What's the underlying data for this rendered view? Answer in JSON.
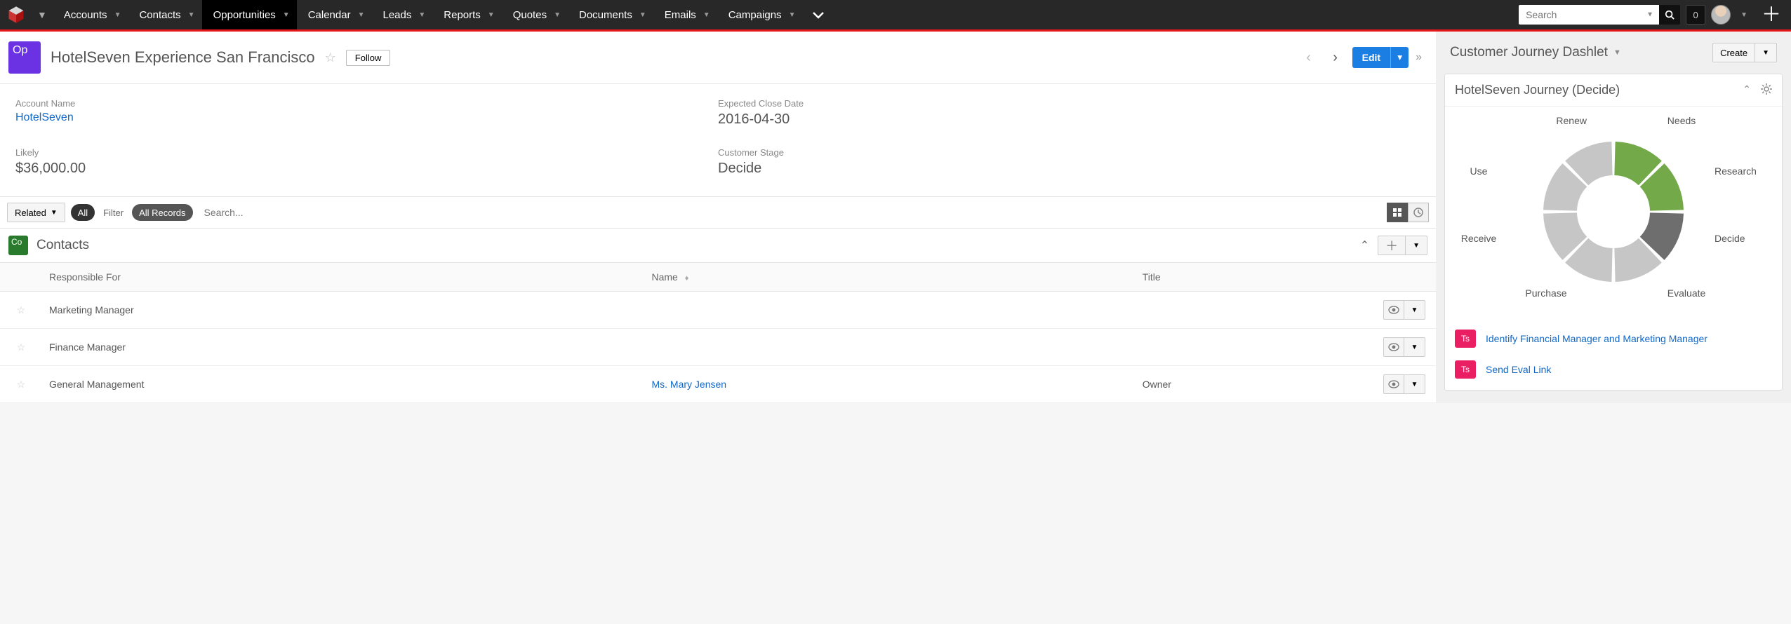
{
  "nav": {
    "items": [
      "Accounts",
      "Contacts",
      "Opportunities",
      "Calendar",
      "Leads",
      "Reports",
      "Quotes",
      "Documents",
      "Emails",
      "Campaigns"
    ],
    "activeIndex": 2,
    "searchPlaceholder": "Search",
    "notifCount": "0"
  },
  "record": {
    "moduleBadge": "Op",
    "title": "HotelSeven Experience San Francisco",
    "followLabel": "Follow",
    "editLabel": "Edit"
  },
  "fields": {
    "accountName": {
      "label": "Account Name",
      "value": "HotelSeven"
    },
    "expectedClose": {
      "label": "Expected Close Date",
      "value": "2016-04-30"
    },
    "likely": {
      "label": "Likely",
      "value": "$36,000.00"
    },
    "stage": {
      "label": "Customer Stage",
      "value": "Decide"
    }
  },
  "related": {
    "relatedLabel": "Related",
    "allPill": "All",
    "filterLabel": "Filter",
    "allRecordsPill": "All Records",
    "searchPlaceholder": "Search..."
  },
  "contactsPanel": {
    "badge": "Co",
    "title": "Contacts",
    "columns": {
      "responsible": "Responsible For",
      "name": "Name",
      "title": "Title"
    },
    "rows": [
      {
        "responsible": "Marketing Manager",
        "name": "",
        "title": ""
      },
      {
        "responsible": "Finance Manager",
        "name": "",
        "title": ""
      },
      {
        "responsible": "General Management",
        "name": "Ms. Mary Jensen",
        "title": "Owner"
      }
    ]
  },
  "sidebar": {
    "dashletTitle": "Customer Journey Dashlet",
    "createLabel": "Create",
    "cardTitle": "HotelSeven Journey (Decide)",
    "wheelLabels": {
      "renew": "Renew",
      "needs": "Needs",
      "research": "Research",
      "decide": "Decide",
      "evaluate": "Evaluate",
      "purchase": "Purchase",
      "receive": "Receive",
      "use": "Use"
    },
    "tasks": [
      {
        "badge": "Ts",
        "label": "Identify Financial Manager and Marketing Manager"
      },
      {
        "badge": "Ts",
        "label": "Send Eval Link"
      }
    ]
  },
  "chart_data": {
    "type": "pie",
    "title": "HotelSeven Journey (Decide)",
    "categories": [
      "Needs",
      "Research",
      "Decide",
      "Evaluate",
      "Purchase",
      "Receive",
      "Use",
      "Renew"
    ],
    "values": [
      1,
      1,
      1,
      1,
      1,
      1,
      1,
      1
    ],
    "status": [
      "done",
      "done",
      "current",
      "pending",
      "pending",
      "pending",
      "pending",
      "pending"
    ],
    "colors": {
      "done": "#74a949",
      "current": "#6e6e6e",
      "pending": "#c6c6c6"
    }
  }
}
